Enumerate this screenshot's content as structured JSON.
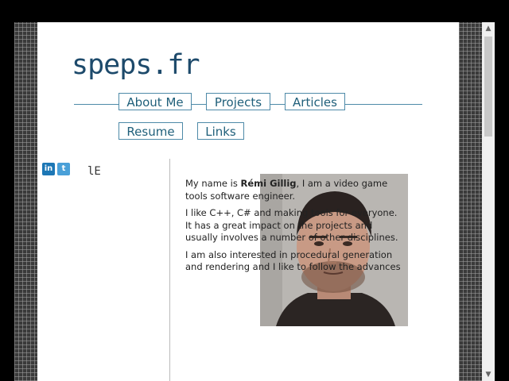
{
  "site": {
    "logo": "speps.fr"
  },
  "nav": {
    "row1": [
      "About Me",
      "Projects",
      "Articles"
    ],
    "row2": [
      "Resume",
      "Links"
    ]
  },
  "social": {
    "linkedin": "in",
    "twitter": "t",
    "misc": "lE"
  },
  "intro": {
    "p1_prefix": "My name is ",
    "name": "Rémi Gillig",
    "p1_suffix": ", I am a video game tools software engineer.",
    "p2": "I like C++, C# and making tools for everyone. It has a great impact on the projects and usually involves a number of other disciplines.",
    "p3": "I am also interested in procedural generation and rendering and I like to follow the advances"
  },
  "scrollbar": {
    "up": "▲",
    "down": "▼"
  },
  "colors": {
    "accent": "#4e8aa8",
    "logo": "#1d4a6b"
  }
}
